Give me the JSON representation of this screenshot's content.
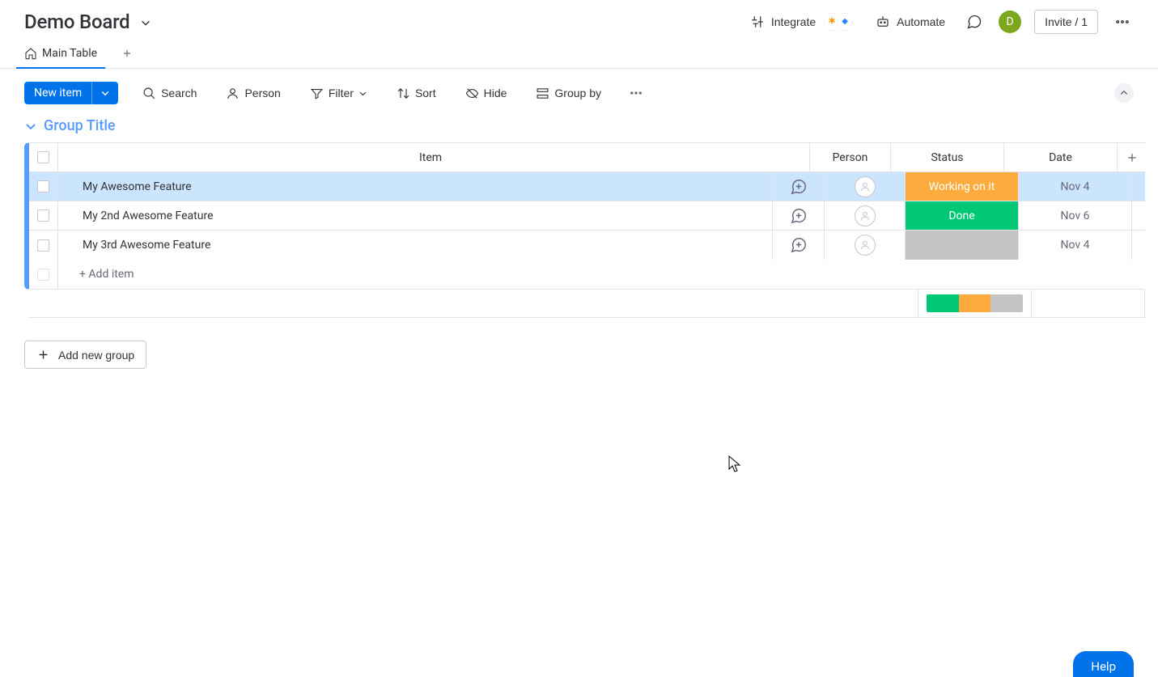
{
  "header": {
    "title": "Demo Board",
    "integrate": "Integrate",
    "automate": "Automate",
    "invite": "Invite / 1",
    "avatar_initial": "D"
  },
  "tabs": {
    "main": "Main Table"
  },
  "toolbar": {
    "new_item": "New item",
    "search": "Search",
    "person": "Person",
    "filter": "Filter",
    "sort": "Sort",
    "hide": "Hide",
    "group_by": "Group by"
  },
  "group": {
    "title": "Group Title",
    "columns": {
      "item": "Item",
      "person": "Person",
      "status": "Status",
      "date": "Date"
    },
    "rows": [
      {
        "name": "My Awesome Feature",
        "status": "Working on it",
        "status_color": "#fdab3d",
        "date": "Nov 4",
        "selected": true
      },
      {
        "name": "My 2nd Awesome Feature",
        "status": "Done",
        "status_color": "#00c875",
        "date": "Nov 6",
        "selected": false
      },
      {
        "name": "My 3rd Awesome Feature",
        "status": "",
        "status_color": "#c4c4c4",
        "date": "Nov 4",
        "selected": false
      }
    ],
    "add_item": "+ Add item",
    "summary_colors": [
      "#00c875",
      "#fdab3d",
      "#c4c4c4"
    ]
  },
  "footer": {
    "add_group": "Add new group"
  },
  "help": "Help"
}
